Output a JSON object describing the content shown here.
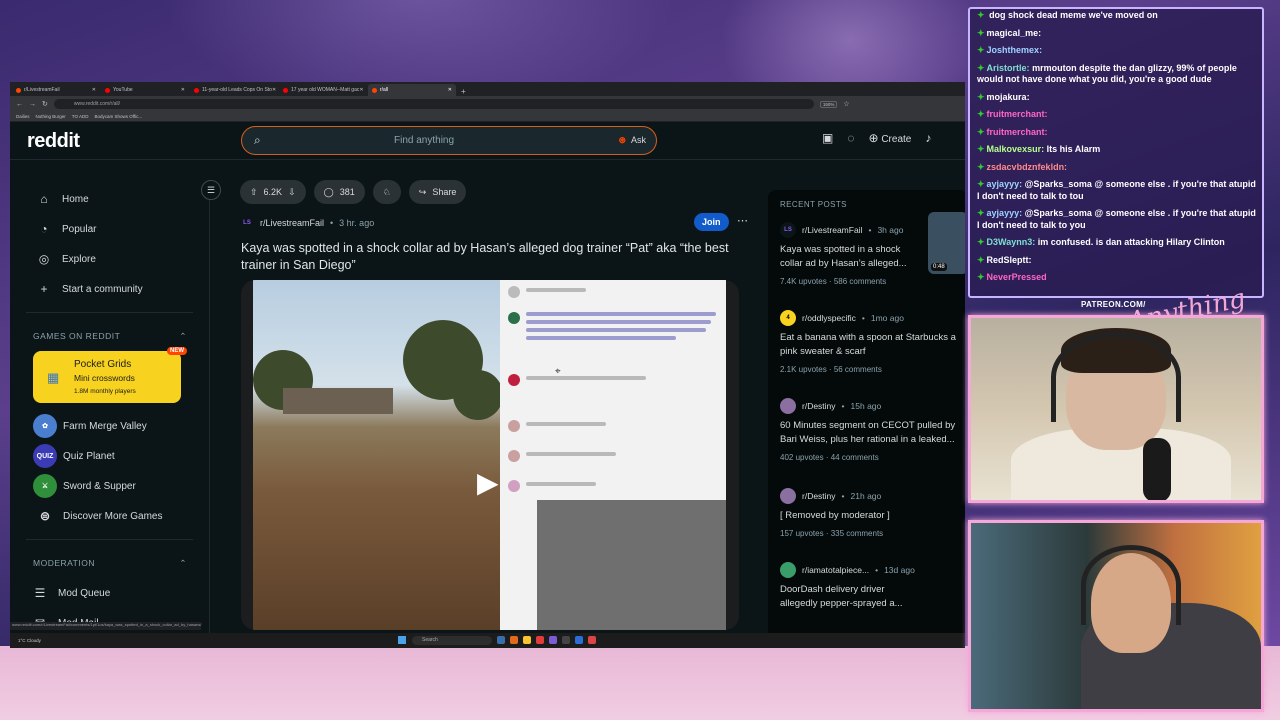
{
  "browser": {
    "tabs": [
      {
        "label": "r/LivestreamFail",
        "active": false
      },
      {
        "label": "YouTube",
        "active": false
      },
      {
        "label": "11-year-old Leads Cops On Sto",
        "active": false
      },
      {
        "label": "17 year old WOMAN--Matt gac",
        "active": false
      },
      {
        "label": "r/all",
        "active": true
      }
    ],
    "url": "www.reddit.com/r/all/",
    "zoom": "150%",
    "bookmarks": [
      "Dailies",
      "Nothing Burger",
      "TO ADD",
      "Bodycam Shows Offic..."
    ],
    "status_url": "www.reddit.com/r/LivestreamFail/comments/1pt/1os/kaya_was_spotted_in_a_shock_collar_ad_by_hasans/"
  },
  "reddit": {
    "logo": "reddit",
    "search_placeholder": "Find anything",
    "ask_label": "Ask",
    "create_label": "Create"
  },
  "sidebar": {
    "nav": [
      {
        "label": "Home",
        "icon": "home-icon"
      },
      {
        "label": "Popular",
        "icon": "popular-icon"
      },
      {
        "label": "Explore",
        "icon": "explore-icon"
      },
      {
        "label": "Start a community",
        "icon": "plus-icon"
      }
    ],
    "games_heading": "GAMES ON REDDIT",
    "featured_game": {
      "title": "Pocket Grids",
      "subtitle": "Mini crosswords",
      "meta": "1.8M monthly players",
      "badge": "NEW"
    },
    "games": [
      {
        "label": "Farm Merge Valley",
        "color": "#4a7fd0",
        "abbr": ""
      },
      {
        "label": "Quiz Planet",
        "color": "#3b3bb5",
        "abbr": "QUIZ"
      },
      {
        "label": "Sword & Supper",
        "color": "#2f8f3a",
        "abbr": ""
      },
      {
        "label": "Discover More Games",
        "color": "",
        "abbr": ""
      }
    ],
    "moderation_heading": "MODERATION",
    "moderation": [
      "Mod Queue",
      "Mod Mail"
    ]
  },
  "post": {
    "upvotes": "6.2K",
    "comments": "381",
    "share_label": "Share",
    "subreddit": "r/LivestreamFail",
    "sub_abbr": "LS",
    "time": "3 hr. ago",
    "join_label": "Join",
    "title": "Kaya was spotted in a shock collar ad by Hasan’s alleged dog trainer “Pat” aka “the best trainer in San Diego”"
  },
  "recent": {
    "heading": "RECENT POSTS",
    "posts": [
      {
        "sub": "r/LivestreamFail",
        "when": "3h ago",
        "title": "Kaya was spotted in a shock collar ad by Hasan’s alleged...",
        "upvotes": "7.4K upvotes",
        "comments": "586 comments",
        "avatar_color": "#0b1416",
        "abbr": "LS",
        "thumb_time": "0:48"
      },
      {
        "sub": "r/oddlyspecific",
        "when": "1mo ago",
        "title": "Eat a banana with a spoon at Starbucks a pink sweater & scarf",
        "upvotes": "2.1K upvotes",
        "comments": "56 comments",
        "avatar_color": "#2b2b2b",
        "abbr": "4"
      },
      {
        "sub": "r/Destiny",
        "when": "15h ago",
        "title": "60 Minutes segment on CECOT pulled by Bari Weiss, plus her rational in a leaked...",
        "upvotes": "402 upvotes",
        "comments": "44 comments",
        "avatar_color": "#8a6fa0",
        "abbr": ""
      },
      {
        "sub": "r/Destiny",
        "when": "21h ago",
        "title": "[ Removed by moderator ]",
        "upvotes": "157 upvotes",
        "comments": "335 comments",
        "avatar_color": "#8a6fa0",
        "abbr": ""
      },
      {
        "sub": "r/iamatotalpiece...",
        "when": "13d ago",
        "title": "DoorDash delivery driver allegedly pepper-sprayed a...",
        "upvotes": "",
        "comments": "",
        "avatar_color": "#3a9e6a",
        "abbr": ""
      }
    ]
  },
  "taskbar": {
    "weather_temp": "1°C",
    "weather_desc": "Cloudy",
    "search": "Search"
  },
  "chat": {
    "messages": [
      {
        "user": "",
        "text": "dog shock dead meme we've moved on",
        "color": "#ff9de0"
      },
      {
        "user": "magical_me:",
        "text": "",
        "color": "#ffffff"
      },
      {
        "user": "Joshthemex:",
        "text": "",
        "color": "#9fd3ff"
      },
      {
        "user": "Aristortle:",
        "text": "mrmouton despite the dan glizzy, 99% of people would not have done what you did, you're a good dude",
        "color": "#7ee0d0"
      },
      {
        "user": "mojakura:",
        "text": "",
        "color": "#ffffff"
      },
      {
        "user": "fruitmerchant:",
        "text": "",
        "color": "#ff66c4"
      },
      {
        "user": "fruitmerchant:",
        "text": "",
        "color": "#ff66c4"
      },
      {
        "user": "Malkovexsur:",
        "text": "Its his Alarm",
        "color": "#b7ff8a"
      },
      {
        "user": "zsdacvbdznfekldn:",
        "text": "",
        "color": "#ff8a8a"
      },
      {
        "user": "ayjayyy:",
        "text": "@Sparks_soma @ someone else . if you're that atupid I don't need to talk to tou",
        "color": "#9fd3ff"
      },
      {
        "user": "ayjayyy:",
        "text": "@Sparks_soma @ someone else . if you're that atupid I don't need to talk to you",
        "color": "#9fd3ff"
      },
      {
        "user": "D3Waynn3:",
        "text": "im confused. is dan attacking Hilary Clinton",
        "color": "#7ee0d0"
      },
      {
        "user": "RedSleptt:",
        "text": "",
        "color": "#ffffff"
      },
      {
        "user": "NeverPressed",
        "text": "",
        "color": "#ff66c4"
      }
    ]
  },
  "overlay": {
    "patreon": "PATREON.COM/",
    "scrawl": "Anything Else?"
  }
}
